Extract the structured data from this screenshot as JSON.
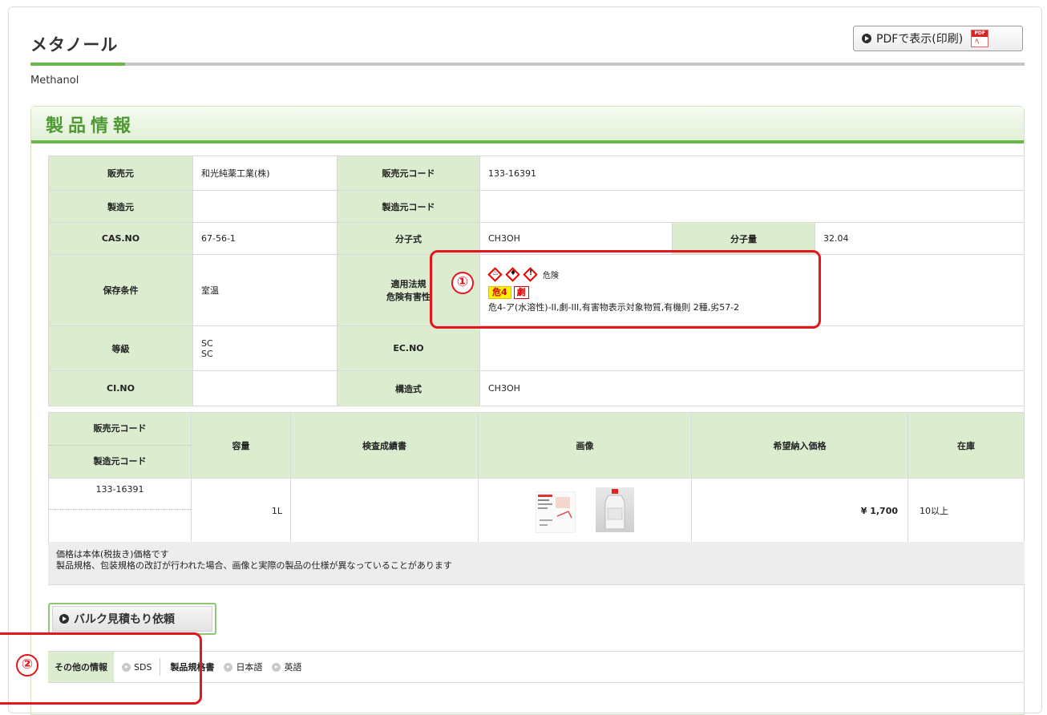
{
  "header": {
    "title": "メタノール",
    "subtitle": "Methanol",
    "pdf_button": "PDFで表示(印刷)"
  },
  "section": {
    "title": "製品情報"
  },
  "info": {
    "seller_label": "販売元",
    "seller": "和光純薬工業(株)",
    "seller_code_label": "販売元コード",
    "seller_code": "133-16391",
    "maker_label": "製造元",
    "maker": "",
    "maker_code_label": "製造元コード",
    "maker_code": "",
    "cas_label": "CAS.NO",
    "cas": "67-56-1",
    "formula_label": "分子式",
    "formula": "CH3OH",
    "mw_label": "分子量",
    "mw": "32.04",
    "storage_label": "保存条件",
    "storage": "室温",
    "law_label_1": "適用法規",
    "law_label_2": "危険有害性",
    "hazard_word": "危険",
    "hazard_badge_1": "危4",
    "hazard_badge_2": "劇",
    "hazard_text": "危4-ア(水溶性)-II,劇-III,有害物表示対象物質,有機則 2種,劣57-2",
    "grade_label": "等級",
    "grade_1": "SC",
    "grade_2": "SC",
    "ec_label": "EC.NO",
    "ec": "",
    "ci_label": "CI.NO",
    "ci": "",
    "structure_label": "構造式",
    "structure": "CH3OH"
  },
  "products": {
    "headers": {
      "seller_code": "販売元コード",
      "maker_code": "製造元コード",
      "capacity": "容量",
      "certificate": "検査成績書",
      "image": "画像",
      "price": "希望納入価格",
      "stock": "在庫"
    },
    "row": {
      "seller_code": "133-16391",
      "maker_code": "",
      "capacity": "1L",
      "certificate": "",
      "price": "¥ 1,700",
      "stock": "10以上"
    }
  },
  "notes": {
    "line1": "価格は本体(税抜き)価格です",
    "line2": "製品規格、包装規格の改訂が行われた場合、画像と実際の製品の仕様が異なっていることがあります"
  },
  "bulk_button": "バルク見積もり依頼",
  "other": {
    "label": "その他の情報",
    "sds": "SDS",
    "spec_label": "製品規格書",
    "japanese": "日本語",
    "english": "英語"
  },
  "annotations": {
    "one": "①",
    "two": "②"
  },
  "colors": {
    "accent_green": "#6ab84b",
    "label_bg": "#dcedcf",
    "annotation_red": "#e3161d"
  }
}
